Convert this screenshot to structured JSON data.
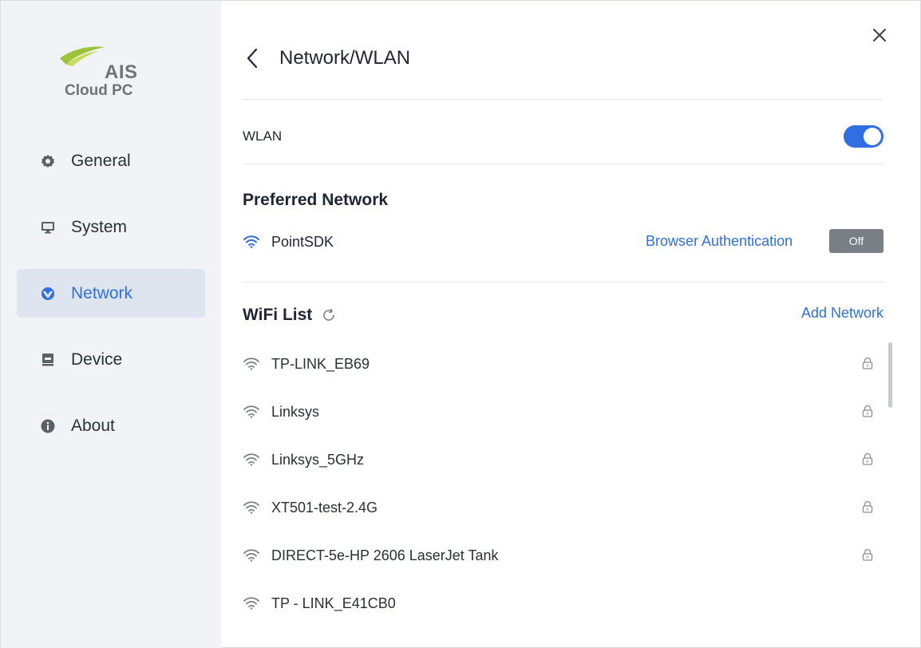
{
  "brand": {
    "name": "AIS",
    "product": "Cloud PC"
  },
  "sidebar": {
    "items": [
      {
        "label": "General",
        "icon": "gear-icon",
        "active": false
      },
      {
        "label": "System",
        "icon": "monitor-icon",
        "active": false
      },
      {
        "label": "Network",
        "icon": "globe-icon",
        "active": true
      },
      {
        "label": "Device",
        "icon": "device-icon",
        "active": false
      },
      {
        "label": "About",
        "icon": "info-icon",
        "active": false
      }
    ]
  },
  "header": {
    "title": "Network/WLAN"
  },
  "wlan": {
    "label": "WLAN",
    "enabled": true
  },
  "preferred": {
    "title": "Preferred Network",
    "network": "PointSDK",
    "browser_auth_label": "Browser Authentication",
    "browser_auth_state": "Off"
  },
  "wifi": {
    "title": "WiFi List",
    "add_label": "Add Network",
    "networks": [
      {
        "name": "TP-LINK_EB69",
        "locked": true
      },
      {
        "name": "Linksys",
        "locked": true
      },
      {
        "name": "Linksys_5GHz",
        "locked": true
      },
      {
        "name": "XT501-test-2.4G",
        "locked": true
      },
      {
        "name": "DIRECT-5e-HP 2606 LaserJet Tank",
        "locked": true
      },
      {
        "name": "TP - LINK_E41CB0",
        "locked": false
      }
    ]
  },
  "colors": {
    "accent": "#2f6fe3",
    "sidebar_bg": "#f1f3f6",
    "active_bg": "#dfe5ef",
    "off_button": "#7a7f86"
  }
}
